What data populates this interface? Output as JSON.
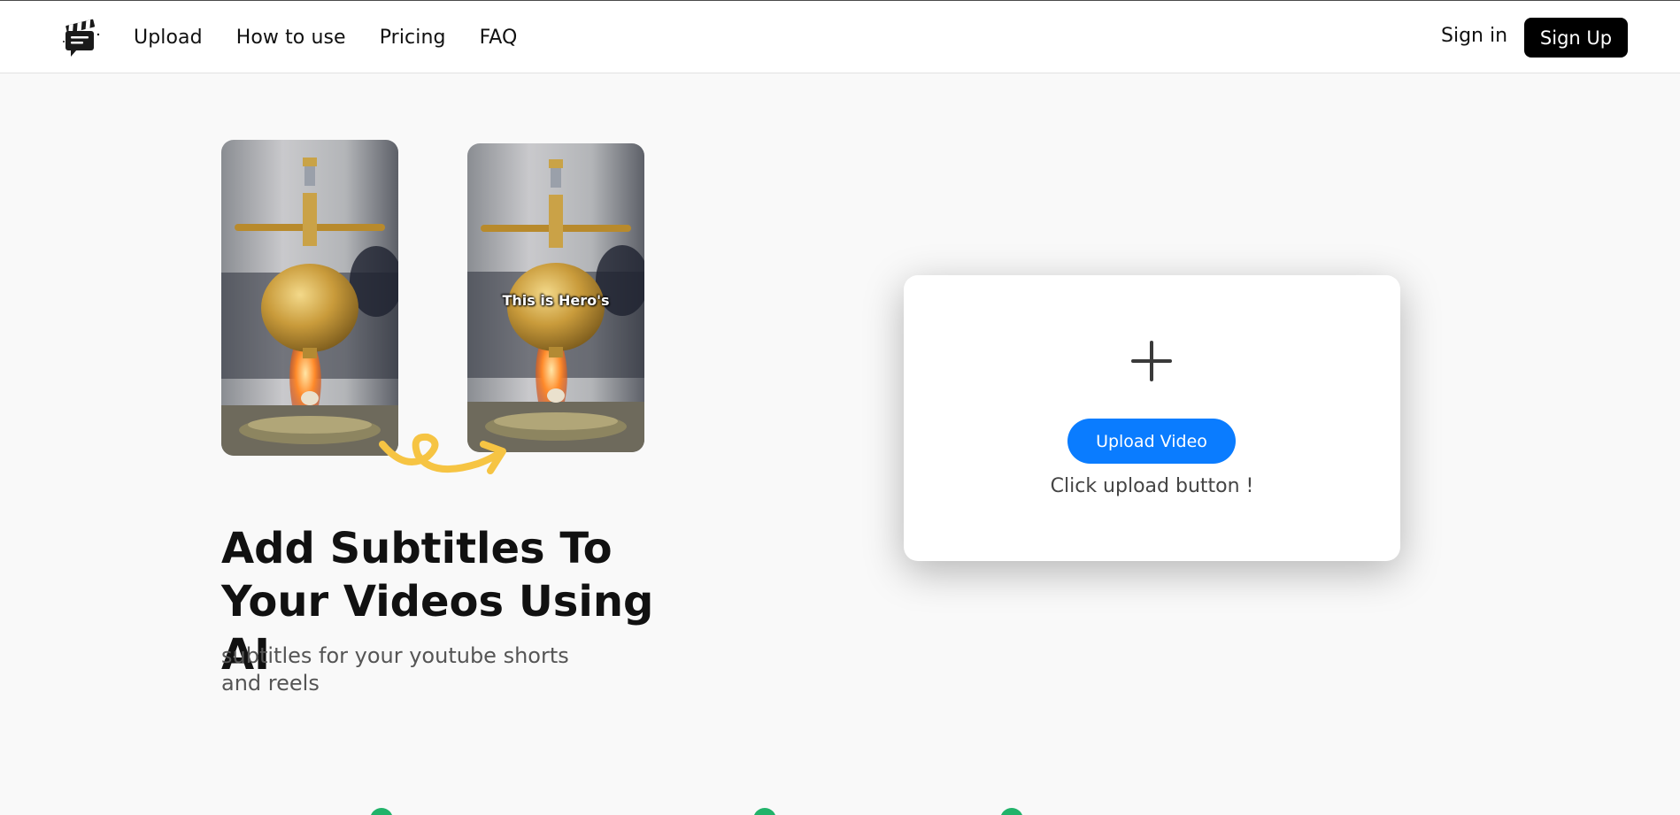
{
  "header": {
    "logo_alt": "clapperboard-chat-logo",
    "nav": [
      {
        "label": "Upload"
      },
      {
        "label": "How to use"
      },
      {
        "label": "Pricing"
      },
      {
        "label": "FAQ"
      }
    ],
    "signin_label": "Sign in",
    "signup_label": "Sign Up"
  },
  "hero": {
    "preview_caption": "This is Hero's",
    "title": "Add Subtitles To Your Videos Using AI",
    "subtitle": "subtitles for your youtube shorts and reels"
  },
  "upload": {
    "icon": "plus-icon",
    "button_label": "Upload Video",
    "hint": "Click upload button !"
  },
  "colors": {
    "accent": "#0a7cff",
    "signup_bg": "#000000",
    "arrow": "#f6c443",
    "feature_check": "#21b36a"
  }
}
